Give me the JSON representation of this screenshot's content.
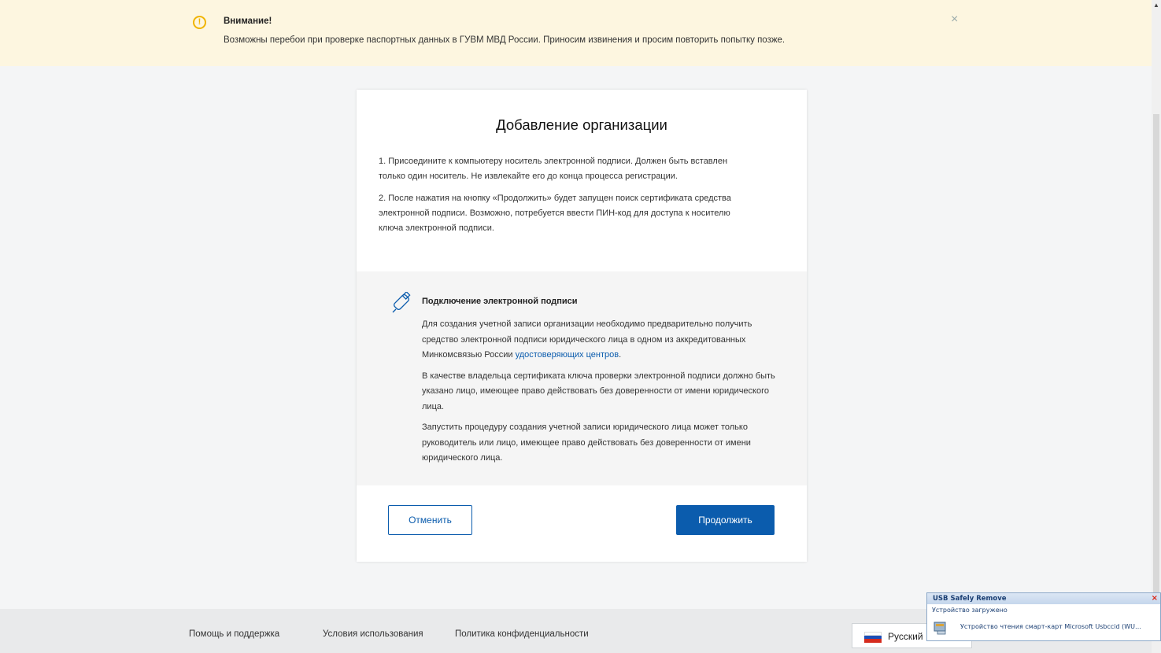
{
  "alert": {
    "title": "Внимание!",
    "text": "Возможны перебои при проверке паспортных данных в ГУВМ МВД России. Приносим извинения и просим повторить попытку позже.",
    "close_glyph": "×",
    "icon": "warning-icon",
    "accent": "#f0b400"
  },
  "card": {
    "title": "Добавление организации",
    "step1": "1. Присоедините к компьютеру носитель электронной подписи. Должен быть вставлен только один носитель. Не извлекайте его до конца процесса регистрации.",
    "step2": "2. После нажатия на кнопку «Продолжить» будет запущен поиск сертификата средства электронной подписи. Возможно, потребуется ввести ПИН-код для доступа к носителю ключа электронной подписи."
  },
  "info": {
    "icon": "usb-key-icon",
    "title": "Подключение электронной подписи",
    "p1_text": "Для создания учетной записи организации необходимо предварительно получить средство электронной подписи юридического лица в одном из аккредитованных Минкомсвязью России ",
    "p1_link": "удостоверяющих центров",
    "p1_end": ".",
    "p2": "В качестве владельца сертификата ключа проверки электронной подписи должно быть указано лицо, имеющее право действовать без доверенности от имени юридического лица.",
    "p3": "Запустить процедуру создания учетной записи юридического лица может только руководитель или лицо, имеющее право действовать без доверенности от имени юридического лица."
  },
  "buttons": {
    "cancel": "Отменить",
    "continue": "Продолжить",
    "primary_color": "#0b5cad"
  },
  "footer": {
    "help": "Помощь и поддержка",
    "terms": "Условия использования",
    "privacy": "Политика конфиденциальности",
    "language": "Русский"
  },
  "usb_popup": {
    "title": "USB Safely Remove",
    "status": "Устройство загружено",
    "device": "Устройство чтения смарт-карт Microsoft Usbccid (WU…",
    "close_glyph": "×"
  }
}
